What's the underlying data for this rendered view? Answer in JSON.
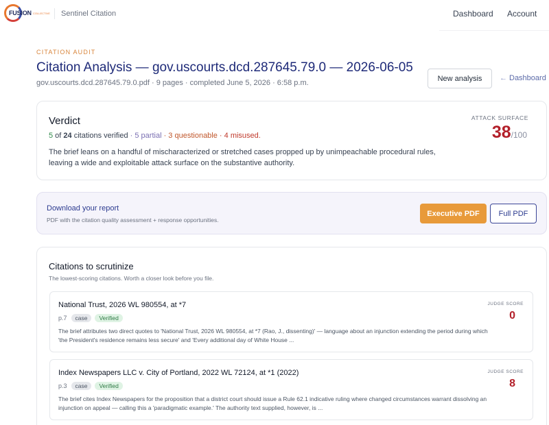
{
  "brand": {
    "logo_text": "FUSION",
    "logo_subtext": "COLLECTIVE",
    "app_name": "Sentinel Citation"
  },
  "nav": {
    "dashboard": "Dashboard",
    "account": "Account"
  },
  "header": {
    "eyebrow": "CITATION AUDIT",
    "title": "Citation Analysis — gov.uscourts.dcd.287645.79.0 — 2026-06-05",
    "meta": "gov.uscourts.dcd.287645.79.0.pdf · 9 pages · completed June 5, 2026 · 6:58 p.m.",
    "new_analysis": "New analysis",
    "back_arrow": "←",
    "back_label": "Dashboard"
  },
  "verdict": {
    "heading": "Verdict",
    "verified_count": "5",
    "of_text": " of ",
    "total_count": "24",
    "verified_text": " citations verified",
    "partial_text": " · 5 partial",
    "questionable_text": " · 3 questionable",
    "misused_text": " · 4 misused.",
    "body": "The brief leans on a handful of mischaracterized or stretched cases propped up by unimpeachable procedural rules, leaving a wide and exploitable attack surface on the substantive authority.",
    "attack_label": "ATTACK SURFACE",
    "attack_score": "38",
    "attack_denominator": "/100"
  },
  "download": {
    "title": "Download your report",
    "subtitle": "PDF with the citation quality assessment + response opportunities.",
    "executive_pdf": "Executive PDF",
    "full_pdf": "Full PDF"
  },
  "citations": {
    "title": "Citations to scrutinize",
    "subtitle": "The lowest-scoring citations. Worth a closer look before you file.",
    "items": [
      {
        "name": "National Trust, 2026 WL 980554, at *7",
        "page": "p.7",
        "type": "case",
        "status": "Verified",
        "description": "The brief attributes two direct quotes to 'National Trust, 2026 WL 980554, at *7 (Rao, J., dissenting)' — language about an injunction extending the period during which 'the President's residence remains less secure' and 'Every additional day of White House ...",
        "judge_label": "JUDGE SCORE",
        "judge_score": "0"
      },
      {
        "name": "Index Newspapers LLC v. City of Portland, 2022 WL 72124, at *1 (2022)",
        "page": "p.3",
        "type": "case",
        "status": "Verified",
        "description": "The brief cites Index Newspapers for the proposition that a district court should issue a Rule 62.1 indicative ruling where changed circumstances warrant dissolving an injunction on appeal — calling this a 'paradigmatic example.' The authority text supplied, however, is ...",
        "judge_label": "JUDGE SCORE",
        "judge_score": "8"
      }
    ]
  }
}
